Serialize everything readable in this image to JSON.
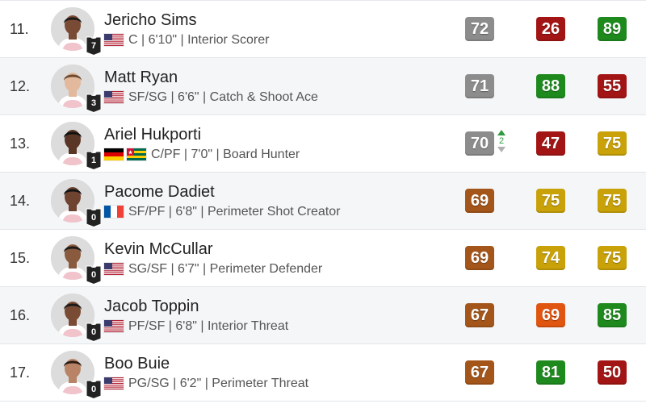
{
  "colors": {
    "gray": "#8a8a8a",
    "dark_red": "#a01313",
    "green": "#1e8a1e",
    "gold": "#c9a208",
    "bronze": "#a4561a",
    "orange": "#e05510"
  },
  "players": [
    {
      "rank": "11.",
      "name": "Jericho Sims",
      "jersey": "7",
      "flags": [
        "us-flag"
      ],
      "meta": "C | 6'10\" | Interior Scorer",
      "skin": "#7a4b34",
      "hair": "#1a1a1a",
      "ratings": [
        {
          "value": "72",
          "color": "#8c8c8c"
        },
        {
          "value": "26",
          "color": "#a31515"
        },
        {
          "value": "89",
          "color": "#1e8a1e"
        }
      ]
    },
    {
      "rank": "12.",
      "name": "Matt Ryan",
      "jersey": "3",
      "flags": [
        "us-flag"
      ],
      "meta": "SF/SG | 6'6\" | Catch & Shoot Ace",
      "skin": "#e2b99c",
      "hair": "#6b4a2e",
      "ratings": [
        {
          "value": "71",
          "color": "#8c8c8c"
        },
        {
          "value": "88",
          "color": "#1e8a1e"
        },
        {
          "value": "55",
          "color": "#a31515"
        }
      ]
    },
    {
      "rank": "13.",
      "name": "Ariel Hukporti",
      "jersey": "1",
      "flags": [
        "germany-flag",
        "togo-flag"
      ],
      "meta": "C/PF | 7'0\" | Board Hunter",
      "skin": "#5a3626",
      "hair": "#111111",
      "trend": "2",
      "ratings": [
        {
          "value": "70",
          "color": "#8c8c8c"
        },
        {
          "value": "47",
          "color": "#a31515"
        },
        {
          "value": "75",
          "color": "#c9a20a"
        }
      ]
    },
    {
      "rank": "14.",
      "name": "Pacome Dadiet",
      "jersey": "0",
      "flags": [
        "france-flag"
      ],
      "meta": "SF/PF | 6'8\" | Perimeter Shot Creator",
      "skin": "#6e4330",
      "hair": "#141414",
      "ratings": [
        {
          "value": "69",
          "color": "#a4561a"
        },
        {
          "value": "75",
          "color": "#c9a20a"
        },
        {
          "value": "75",
          "color": "#c9a20a"
        }
      ]
    },
    {
      "rank": "15.",
      "name": "Kevin McCullar",
      "jersey": "0",
      "flags": [
        "us-flag"
      ],
      "meta": "SG/SF | 6'7\" | Perimeter Defender",
      "skin": "#8a5a3e",
      "hair": "#1a1a1a",
      "ratings": [
        {
          "value": "69",
          "color": "#a4561a"
        },
        {
          "value": "74",
          "color": "#c9a20a"
        },
        {
          "value": "75",
          "color": "#c9a20a"
        }
      ]
    },
    {
      "rank": "16.",
      "name": "Jacob Toppin",
      "jersey": "0",
      "flags": [
        "us-flag"
      ],
      "meta": "PF/SF | 6'8\" | Interior Threat",
      "skin": "#7a4b34",
      "hair": "#1a1a1a",
      "ratings": [
        {
          "value": "67",
          "color": "#a4561a"
        },
        {
          "value": "69",
          "color": "#e0550f"
        },
        {
          "value": "85",
          "color": "#1e8a1e"
        }
      ]
    },
    {
      "rank": "17.",
      "name": "Boo Buie",
      "jersey": "0",
      "flags": [
        "us-flag"
      ],
      "meta": "PG/SG | 6'2\" | Perimeter Threat",
      "skin": "#b98466",
      "hair": "#2a1c14",
      "ratings": [
        {
          "value": "67",
          "color": "#a4561a"
        },
        {
          "value": "81",
          "color": "#1e8a1e"
        },
        {
          "value": "50",
          "color": "#a31515"
        }
      ]
    }
  ]
}
